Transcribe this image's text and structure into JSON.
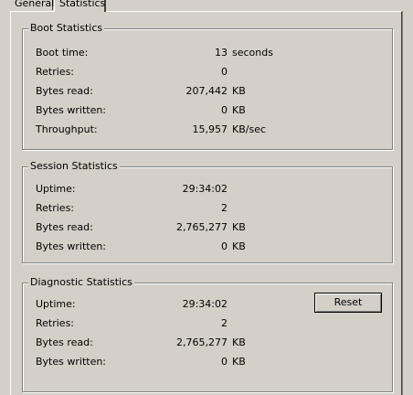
{
  "tabs": [
    {
      "label": "General"
    },
    {
      "label": "Statistics"
    }
  ],
  "boot": {
    "title": "Boot Statistics",
    "rows": [
      {
        "label": "Boot time:",
        "value": "13",
        "unit": "seconds"
      },
      {
        "label": "Retries:",
        "value": "0",
        "unit": ""
      },
      {
        "label": "Bytes read:",
        "value": "207,442",
        "unit": "KB"
      },
      {
        "label": "Bytes written:",
        "value": "0",
        "unit": "KB"
      },
      {
        "label": "Throughput:",
        "value": "15,957",
        "unit": "KB/sec"
      }
    ]
  },
  "session": {
    "title": "Session Statistics",
    "rows": [
      {
        "label": "Uptime:",
        "value": "29:34:02",
        "unit": ""
      },
      {
        "label": "Retries:",
        "value": "2",
        "unit": ""
      },
      {
        "label": "Bytes read:",
        "value": "2,765,277",
        "unit": "KB"
      },
      {
        "label": "Bytes written:",
        "value": "0",
        "unit": "KB"
      }
    ]
  },
  "diagnostic": {
    "title": "Diagnostic Statistics",
    "reset_label": "Reset",
    "rows": [
      {
        "label": "Uptime:",
        "value": "29:34:02",
        "unit": ""
      },
      {
        "label": "Retries:",
        "value": "2",
        "unit": ""
      },
      {
        "label": "Bytes read:",
        "value": "2,765,277",
        "unit": "KB"
      },
      {
        "label": "Bytes written:",
        "value": "0",
        "unit": "KB"
      }
    ]
  }
}
